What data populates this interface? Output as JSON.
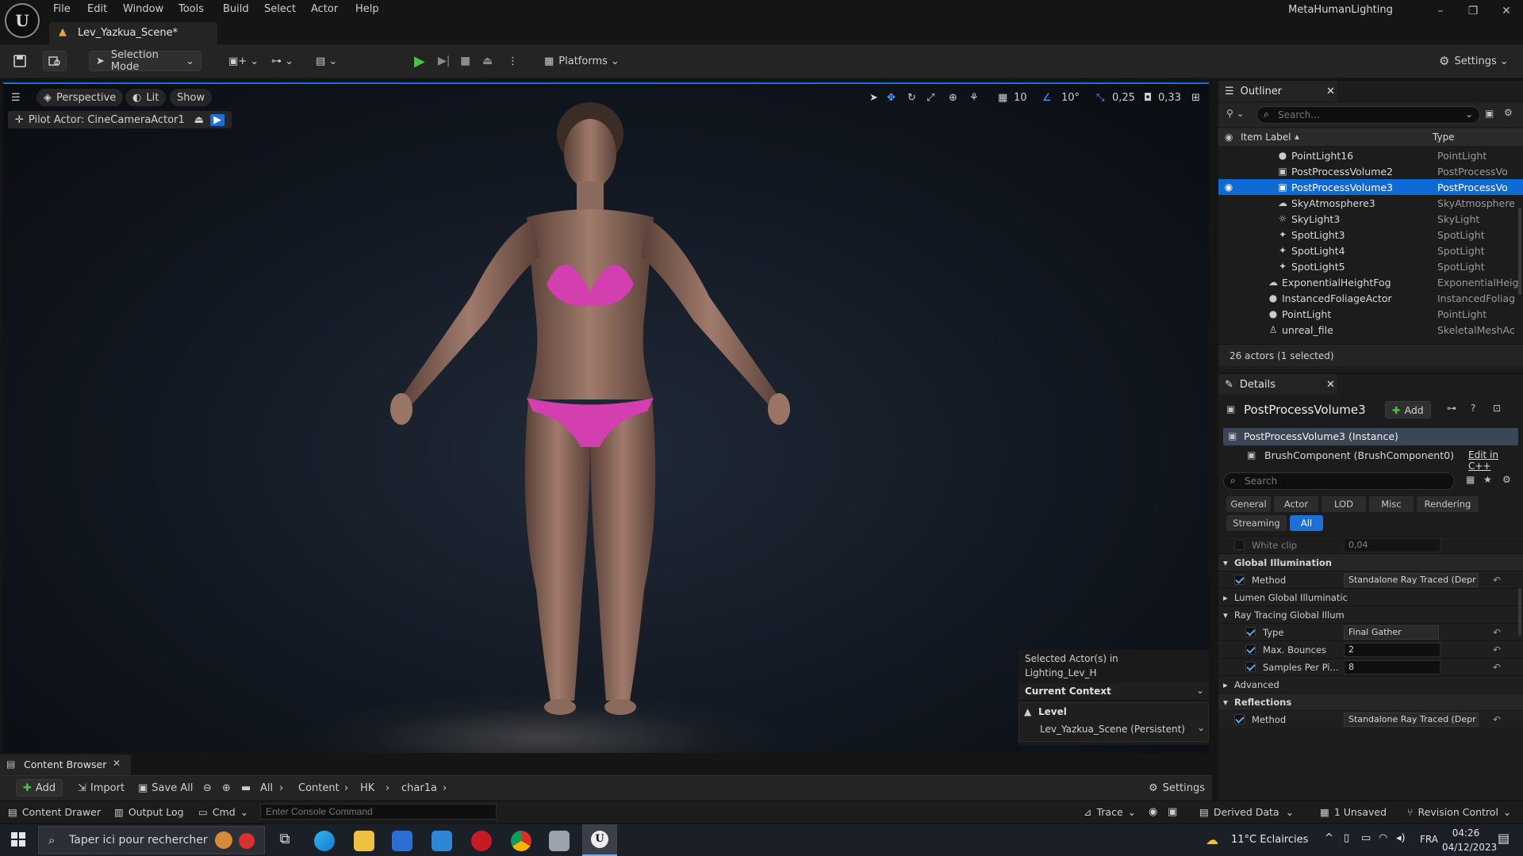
{
  "menu": [
    "File",
    "Edit",
    "Window",
    "Tools",
    "Build",
    "Select",
    "Actor",
    "Help"
  ],
  "app_title": "MetaHumanLighting",
  "tab": {
    "title": "Lev_Yazkua_Scene*"
  },
  "toolbar": {
    "mode_label": "Selection Mode",
    "platforms_label": "Platforms",
    "settings_label": "Settings"
  },
  "viewport": {
    "perspective_label": "Perspective",
    "lit_label": "Lit",
    "show_label": "Show",
    "pilot_label": "Pilot Actor: CineCameraActor1",
    "grid_value": "10",
    "angle_value": "10°",
    "scale_value": "0,25",
    "camera_speed": "0,33",
    "context": {
      "selected_text": "Selected Actor(s) in",
      "level_name": "Lighting_Lev_H",
      "current_context": "Current Context",
      "level_label": "Level",
      "level_value": "Lev_Yazkua_Scene (Persistent)"
    }
  },
  "content_browser": {
    "tab_label": "Content Browser",
    "add_label": "Add",
    "import_label": "Import",
    "save_all_label": "Save All",
    "path": [
      "All",
      "Content",
      "HK",
      "char1a"
    ],
    "settings_label": "Settings"
  },
  "statusbar": {
    "content_drawer": "Content Drawer",
    "output_log": "Output Log",
    "cmd": "Cmd",
    "console_placeholder": "Enter Console Command",
    "trace": "Trace",
    "derived_data": "Derived Data",
    "unsaved": "1 Unsaved",
    "revision_control": "Revision Control"
  },
  "outliner": {
    "tab_label": "Outliner",
    "search_placeholder": "Search...",
    "col_label": "Item Label",
    "col_type": "Type",
    "rows": [
      {
        "name": "PointLight16",
        "type": "PointLight"
      },
      {
        "name": "PostProcessVolume2",
        "type": "PostProcessVo"
      },
      {
        "name": "PostProcessVolume3",
        "type": "PostProcessVo"
      },
      {
        "name": "SkyAtmosphere3",
        "type": "SkyAtmosphere"
      },
      {
        "name": "SkyLight3",
        "type": "SkyLight"
      },
      {
        "name": "SpotLight3",
        "type": "SpotLight"
      },
      {
        "name": "SpotLight4",
        "type": "SpotLight"
      },
      {
        "name": "SpotLight5",
        "type": "SpotLight"
      },
      {
        "name": "ExponentialHeightFog",
        "type": "ExponentialHeig"
      },
      {
        "name": "InstancedFoliageActor",
        "type": "InstancedFoliag"
      },
      {
        "name": "PointLight",
        "type": "PointLight"
      },
      {
        "name": "unreal_file",
        "type": "SkeletalMeshAc"
      }
    ],
    "footer": "26 actors (1 selected)"
  },
  "details": {
    "tab_label": "Details",
    "object_name": "PostProcessVolume3",
    "add_label": "Add",
    "instance_label": "PostProcessVolume3 (Instance)",
    "brush_label": "BrushComponent (BrushComponent0)",
    "edit_cpp": "Edit in C++",
    "search_placeholder": "Search",
    "filters": [
      "General",
      "Actor",
      "LOD",
      "Misc",
      "Rendering",
      "Streaming",
      "All"
    ],
    "props": {
      "white_clip_label": "White clip",
      "white_clip_value": "0,04",
      "gi_header": "Global Illumination",
      "method_label": "Method",
      "method_value": "Standalone Ray Traced (Depr",
      "lumen_gi": "Lumen Global Illuminatic",
      "rtgi": "Ray Tracing Global Illum",
      "type_label": "Type",
      "type_value": "Final Gather",
      "bounces_label": "Max. Bounces",
      "bounces_value": "2",
      "samples_label": "Samples Per Pi...",
      "samples_value": "8",
      "advanced": "Advanced",
      "reflections_header": "Reflections",
      "refl_method_label": "Method",
      "refl_method_value": "Standalone Ray Traced (Depr"
    }
  },
  "taskbar": {
    "search_placeholder": "Taper ici pour rechercher",
    "weather": "11°C Eclaircies",
    "lang": "FRA",
    "time": "04:26",
    "date": "04/12/2023"
  }
}
